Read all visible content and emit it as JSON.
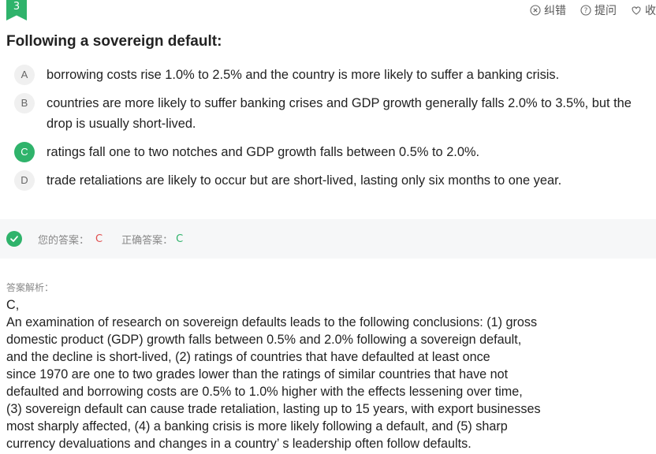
{
  "question": {
    "number": "3",
    "stem": "Following a sovereign default:"
  },
  "actions": [
    {
      "icon": "error-icon",
      "label": "纠错"
    },
    {
      "icon": "question-icon",
      "label": "提问"
    },
    {
      "icon": "heart-icon",
      "label": "收"
    }
  ],
  "options": [
    {
      "letter": "A",
      "text": "borrowing costs rise 1.0% to 2.5% and the country is more likely to suffer a banking crisis.",
      "correct": false
    },
    {
      "letter": "B",
      "text": "countries are more likely to suffer banking crises and GDP growth generally falls 2.0% to 3.5%, but the drop is usually short-lived.",
      "correct": false
    },
    {
      "letter": "C",
      "text": "ratings fall one to two notches and GDP growth falls between 0.5% to 2.0%.",
      "correct": true
    },
    {
      "letter": "D",
      "text": "trade retaliations are likely to occur but are short-lived, lasting only six months to one year.",
      "correct": false
    }
  ],
  "result": {
    "your_answer_label": "您的答案：",
    "your_answer": "C",
    "correct_answer_label": "正确答案：",
    "correct_answer": "C"
  },
  "explanation": {
    "label": "答案解析：",
    "answer": "C,",
    "body": "An examination of research on sovereign defaults leads to the following conclusions: (1) gross\ndomestic product (GDP) growth falls between 0.5% and 2.0% following a sovereign default,\nand the decline is short-lived, (2) ratings of countries that have defaulted at least once\nsince 1970 are one to two grades lower than the ratings of similar countries that have not\ndefaulted and borrowing costs are 0.5% to 1.0% higher with the effects lessening over time,\n(3) sovereign default can cause trade retaliation, lasting up to 15 years, with export businesses\nmost sharply affected, (4) a banking crisis is more likely following a default, and (5) sharp\ncurrency devaluations and changes in a country’ s leadership often follow defaults."
  },
  "colors": {
    "accent_green": "#2fb36b",
    "wrong_red": "#e05050"
  }
}
